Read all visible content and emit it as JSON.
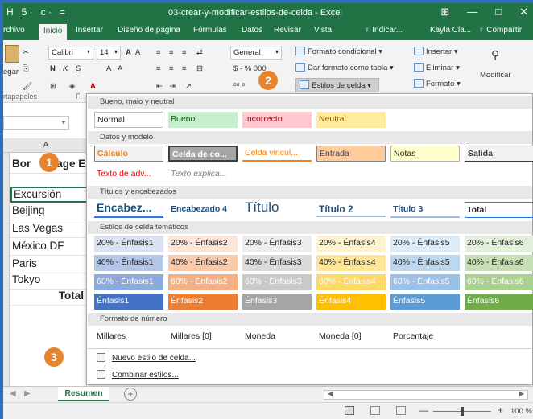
{
  "window": {
    "title": "03-crear-y-modificar-estilos-de-celda - Excel",
    "qat": [
      "H",
      "5 ·",
      "c ·",
      "="
    ],
    "controls": [
      "⊞",
      "—",
      "□",
      "✕"
    ]
  },
  "tabs": {
    "items": [
      "rchivo",
      "Inicio",
      "Insertar",
      "Diseño de página",
      "Fórmulas",
      "Datos",
      "Revisar",
      "Vista"
    ],
    "active": "Inicio",
    "tell_me": "♀ Indicar...",
    "user": "Kayla Cla...",
    "share": "♀ Compartir"
  },
  "ribbon": {
    "paste_label": "egar",
    "font_name": "Calibri",
    "font_size": "14",
    "number_format": "General",
    "currency_row": "$ - % 000",
    "conditional_format": "Formato condicional",
    "format_as_table": "Dar formato como tabla",
    "cell_styles": "Estilos de celda",
    "insert": "Insertar",
    "delete": "Eliminar",
    "format": "Formato",
    "modify": "Modificar",
    "clipboard_group": "rtapapeles",
    "font_group_letter": "Fi"
  },
  "callouts": [
    "1",
    "2",
    "3"
  ],
  "sheet": {
    "column_label": "A",
    "cells": [
      "Bor",
      "age Ex",
      "Excursión",
      "Beijing",
      "Las Vegas",
      "México DF",
      "Paris",
      "Tokyo",
      "Total"
    ]
  },
  "gallery": {
    "sections": {
      "good_bad": "Bueno, malo y neutral",
      "data_model": "Datos y modelo",
      "titles": "Títulos y encabezados",
      "themed": "Estilos de celda temáticos",
      "number_format": "Formato de número"
    },
    "good_bad": [
      "Normal",
      "Bueno",
      "Incorrecto",
      "Neutral"
    ],
    "data_model_row1": [
      "Cálculo",
      "Celda de co...",
      "Celda vincul...",
      "Entrada",
      "Notas",
      "Salida"
    ],
    "data_model_row2": [
      "Texto de adv...",
      "Texto explica..."
    ],
    "titles": [
      "Encabez...",
      "Encabezado 4",
      "Título",
      "Título 2",
      "Título 3",
      "Total"
    ],
    "themed_20": [
      "20% - Énfasis1",
      "20% - Énfasis2",
      "20% - Énfasis3",
      "20% - Énfasis4",
      "20% - Énfasis5",
      "20% - Énfasis6"
    ],
    "themed_40": [
      "40% - Énfasis1",
      "40% - Énfasis2",
      "40% - Énfasis3",
      "40% - Énfasis4",
      "40% - Énfasis5",
      "40% - Énfasis6"
    ],
    "themed_60": [
      "60% - Énfasis1",
      "60% - Énfasis2",
      "60% - Énfasis3",
      "60% - Énfasis4",
      "60% - Énfasis5",
      "60% - Énfasis6"
    ],
    "themed_full": [
      "Énfasis1",
      "Énfasis2",
      "Énfasis3",
      "Énfasis4",
      "Énfasis5",
      "Énfasis6"
    ],
    "number_formats": [
      "Millares",
      "Millares [0]",
      "Moneda",
      "Moneda [0]",
      "Porcentaje"
    ],
    "menu": {
      "new_style": "Nuevo estilo de celda...",
      "merge_styles": "Combinar estilos..."
    }
  },
  "sheet_tabs": {
    "active": "Resumen",
    "add": "+"
  },
  "status": {
    "zoom": "100 %"
  },
  "colors": {
    "excel_green": "#217346",
    "frame_blue": "#2f6db5",
    "callout_orange": "#e8832c"
  }
}
